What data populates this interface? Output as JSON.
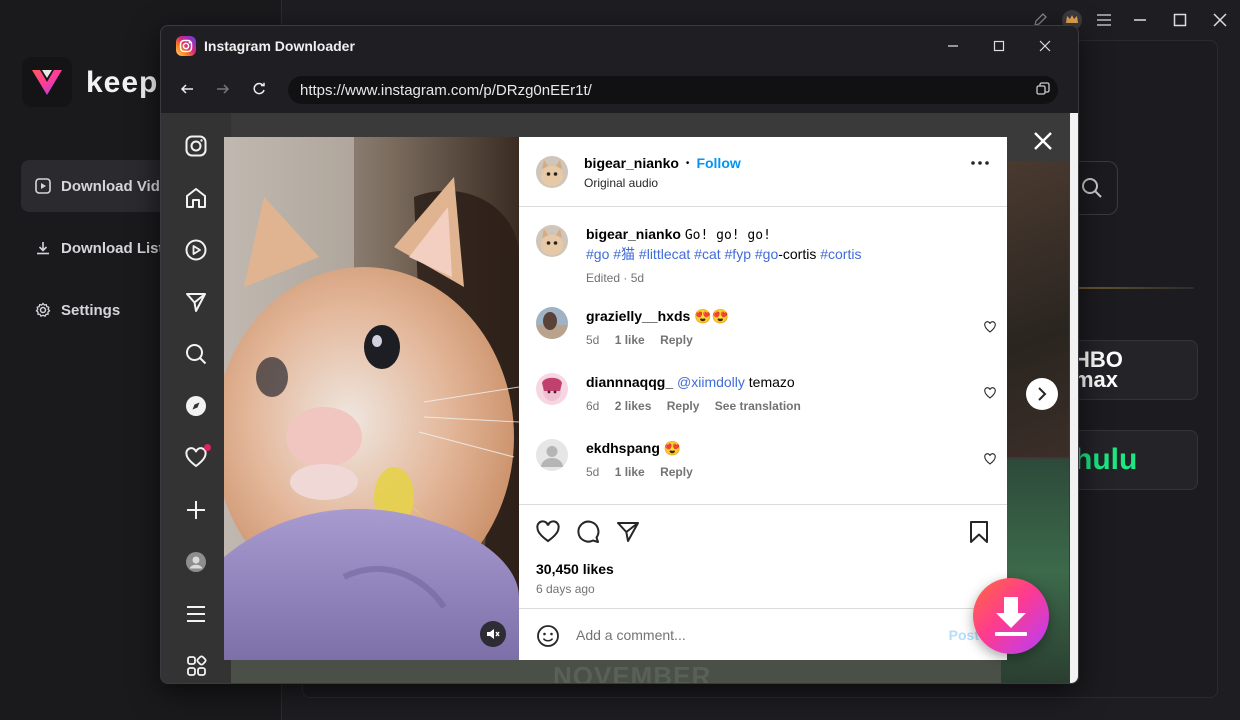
{
  "app": {
    "logo_text": "keepr",
    "nav": [
      {
        "label": "Download Video",
        "icon": "play-square-icon",
        "active": true
      },
      {
        "label": "Download List",
        "icon": "download-icon",
        "active": false
      },
      {
        "label": "Settings",
        "icon": "gear-icon",
        "active": false
      }
    ],
    "services": {
      "hbo": "HBO\nmax",
      "hulu": "hulu"
    }
  },
  "window": {
    "title": "Instagram Downloader",
    "url": "https://www.instagram.com/p/DRzg0nEEr1t/"
  },
  "post": {
    "author": "bigear_nianko",
    "follow_label": "Follow",
    "audio": "Original audio",
    "caption": {
      "user": "bigear_nianko",
      "text": "Go! go! go!",
      "tags_line_1": "#go #猫 #littlecat #cat #fyp #go",
      "tags_mid": "-cortis ",
      "tags_end": "#cortis",
      "meta": "Edited · 5d"
    },
    "comments": [
      {
        "user": "grazielly__hxds",
        "text": "😍😍",
        "time": "5d",
        "likes": "1 like",
        "reply": "Reply",
        "extra": ""
      },
      {
        "user": "diannnaqqg_",
        "mention": "@xiimdolly",
        "text": "temazo",
        "time": "6d",
        "likes": "2 likes",
        "reply": "Reply",
        "extra": "See translation"
      },
      {
        "user": "ekdhspang",
        "text": "😍",
        "time": "5d",
        "likes": "1 like",
        "reply": "Reply",
        "extra": ""
      }
    ],
    "likes": "30,450 likes",
    "ago": "6 days ago",
    "comment_placeholder": "Add a comment...",
    "post_label": "Post"
  },
  "background": {
    "november": "NOVEMBER"
  },
  "colors": {
    "accent_blue": "#0095f6",
    "fab_start": "#ff6a3d",
    "fab_end": "#b43cff"
  }
}
